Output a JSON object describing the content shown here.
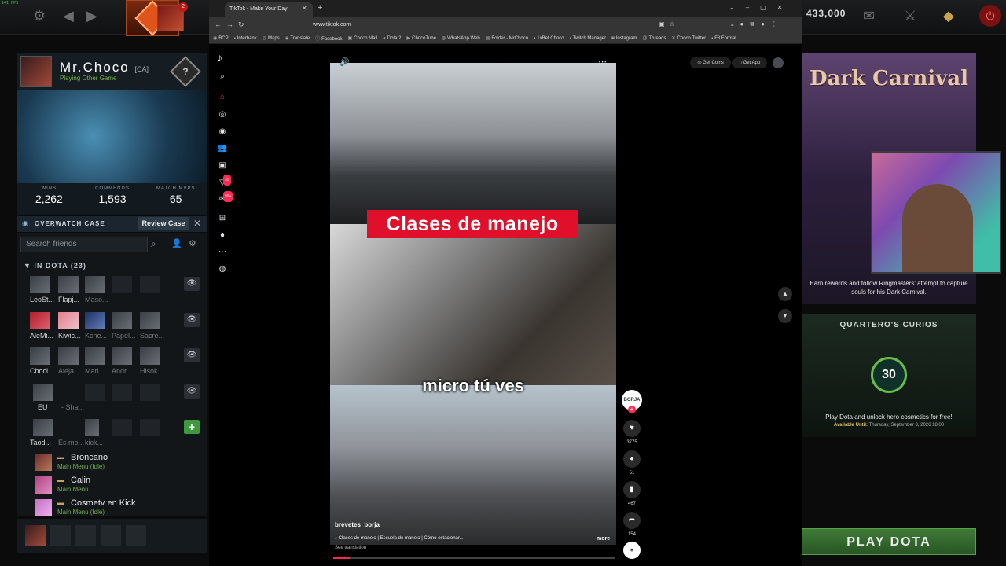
{
  "hud": {
    "fps": "141 FPS",
    "gold": "433,000"
  },
  "profile": {
    "name": "Mr.Choco",
    "tag": "[CA]",
    "status": "Playing Other Game",
    "quests_icon": "?",
    "stats": [
      {
        "label": "WINS",
        "value": "2,262"
      },
      {
        "label": "COMMENDS",
        "value": "1,593"
      },
      {
        "label": "MATCH MVPS",
        "value": "65"
      }
    ]
  },
  "overwatch": {
    "title": "OVERWATCH CASE",
    "button": "Review Case",
    "close": "✕"
  },
  "friends": {
    "search_placeholder": "Search friends",
    "group_label": "IN DOTA (23)",
    "rows": [
      [
        "LeoSt...",
        "Flapj...",
        "Maso..."
      ],
      [
        "AleMi...",
        "Kiwic...",
        "Kche...",
        "Papel...",
        "Sacre..."
      ],
      [
        "Chocl...",
        "Aleja...",
        "Mari...",
        "Andr...",
        "Hisok..."
      ],
      [
        "EU",
        "- Sha..."
      ],
      [
        "Taod...",
        "Es mo...",
        "kick..."
      ]
    ],
    "list": [
      {
        "name": "Broncano",
        "status": "Main Menu (Idle)"
      },
      {
        "name": "Calin",
        "status": "Main Menu"
      },
      {
        "name": "Cosmetv en Kick",
        "status": "Main Menu (Idle)"
      }
    ],
    "notification_count": "2"
  },
  "browser": {
    "tab_title": "TikTok - Make Your Day",
    "url": "www.tiktok.com",
    "bookmarks": [
      "BCP",
      "Interbank",
      "Maps",
      "Translate",
      "Facebook",
      "Choco Mail",
      "Dota 2",
      "ChocoTube",
      "WhatsApp Web",
      "Folder - MrChoco",
      "1xBet Choco",
      "Twitch Manager",
      "Instagram",
      "Threads",
      "Choco Twitter",
      "F8 Format"
    ]
  },
  "tiktok": {
    "get_coins": "Get Coins",
    "get_app": "Get App",
    "badge_count_1": "35",
    "badge_count_2": "99+",
    "caption": "Clases de manejo",
    "subtitle": "micro tú ves",
    "author": "brevetes_borja",
    "description": "Clases de manejo | Escuela de manejo | Cómo estacionar...",
    "more": "more",
    "see_translation": "See translation",
    "avatar_label": "BORJA",
    "likes": "3775",
    "comments": "51",
    "saves": "467",
    "shares": "154",
    "progress": 0.06
  },
  "dark_carnival": {
    "title": "Dark Carnival",
    "text": "Earn rewards and follow Ringmasters' attempt to capture souls for his Dark Carnival."
  },
  "quartero": {
    "title": "QUARTERO'S CURIOS",
    "badge": "30",
    "text": "Play Dota and unlock hero cosmetics for free!",
    "date_label": "Available Until:",
    "date": "Thursday, September 3, 2026 18:00"
  },
  "play_button": "PLAY DOTA"
}
